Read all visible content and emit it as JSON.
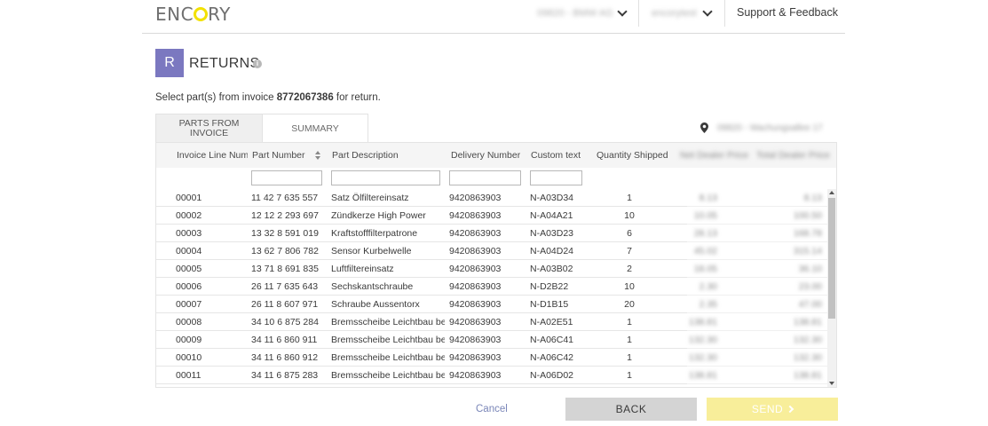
{
  "header": {
    "logo_pre": "ENC",
    "logo_post": "RY",
    "dropdown1": "09820 - BMW AG",
    "dropdown2": "encorytest",
    "support": "Support & Feedback"
  },
  "page": {
    "badge": "R",
    "title": "RETURNS",
    "instruction_pre": "Select part(s) from invoice ",
    "invoice_number": "8772067386",
    "instruction_post": " for return."
  },
  "tabs": {
    "parts_line1": "PARTS FROM",
    "parts_line2": "INVOICE",
    "summary": "SUMMARY",
    "location": "09820 - Wachungsallee 17"
  },
  "table": {
    "headers": {
      "invoice_line": "Invoice Line Numb",
      "part_number": "Part Number",
      "part_description": "Part Description",
      "delivery_number": "Delivery Number",
      "custom_text": "Custom text",
      "quantity_shipped": "Quantity Shipped",
      "net_dealer_price": "Net Dealer Price",
      "total_dealer_price": "Total Dealer Price"
    },
    "rows": [
      {
        "line": "00001",
        "part": "11 42 7 635 557",
        "desc": "Satz Ölfiltereinsatz",
        "delivery": "9420863903",
        "custom": "N-A03D34",
        "qty": "1",
        "net": "8.13",
        "total": "8.13"
      },
      {
        "line": "00002",
        "part": "12 12 2 293 697",
        "desc": "Zündkerze High Power",
        "delivery": "9420863903",
        "custom": "N-A04A21",
        "qty": "10",
        "net": "10.05",
        "total": "100.50"
      },
      {
        "line": "00003",
        "part": "13 32 8 591 019",
        "desc": "Kraftstofffilterpatrone",
        "delivery": "9420863903",
        "custom": "N-A03D23",
        "qty": "6",
        "net": "28.13",
        "total": "168.78"
      },
      {
        "line": "00004",
        "part": "13 62 7 806 782",
        "desc": "Sensor Kurbelwelle",
        "delivery": "9420863903",
        "custom": "N-A04D24",
        "qty": "7",
        "net": "45.02",
        "total": "315.14"
      },
      {
        "line": "00005",
        "part": "13 71 8 691 835",
        "desc": "Luftfiltereinsatz",
        "delivery": "9420863903",
        "custom": "N-A03B02",
        "qty": "2",
        "net": "18.05",
        "total": "36.10"
      },
      {
        "line": "00006",
        "part": "26 11 7 635 643",
        "desc": "Sechskantschraube",
        "delivery": "9420863903",
        "custom": "N-D2B22",
        "qty": "10",
        "net": "2.30",
        "total": "23.00"
      },
      {
        "line": "00007",
        "part": "26 11 8 607 971",
        "desc": "Schraube Aussentorx",
        "delivery": "9420863903",
        "custom": "N-D1B15",
        "qty": "20",
        "net": "2.35",
        "total": "47.00"
      },
      {
        "line": "00008",
        "part": "34 10 6 875 284",
        "desc": "Bremsscheibe Leichtbau be...",
        "delivery": "9420863903",
        "custom": "N-A02E51",
        "qty": "1",
        "net": "138.81",
        "total": "138.81"
      },
      {
        "line": "00009",
        "part": "34 11 6 860 911",
        "desc": "Bremsscheibe Leichtbau be...",
        "delivery": "9420863903",
        "custom": "N-A06C41",
        "qty": "1",
        "net": "132.30",
        "total": "132.30"
      },
      {
        "line": "00010",
        "part": "34 11 6 860 912",
        "desc": "Bremsscheibe Leichtbau be...",
        "delivery": "9420863903",
        "custom": "N-A06C42",
        "qty": "1",
        "net": "132.30",
        "total": "132.30"
      },
      {
        "line": "00011",
        "part": "34 11 6 875 283",
        "desc": "Bremsscheibe Leichtbau be...",
        "delivery": "9420863903",
        "custom": "N-A06D02",
        "qty": "1",
        "net": "138.81",
        "total": "138.81"
      }
    ]
  },
  "footer": {
    "cancel": "Cancel",
    "back": "BACK",
    "send": "SEND"
  },
  "colors": {
    "badge": "#7b78c0",
    "logo_ring": "#f2e100",
    "send_button": "#f8ee9a",
    "back_button": "#d4d4d4",
    "cancel_link": "#7a86b8"
  },
  "icons": {
    "info": "info-icon",
    "location": "location-pin-icon",
    "sort": "sort-icon",
    "chevron": "chevron-down-icon",
    "send_chevron": "chevron-right-icon"
  }
}
